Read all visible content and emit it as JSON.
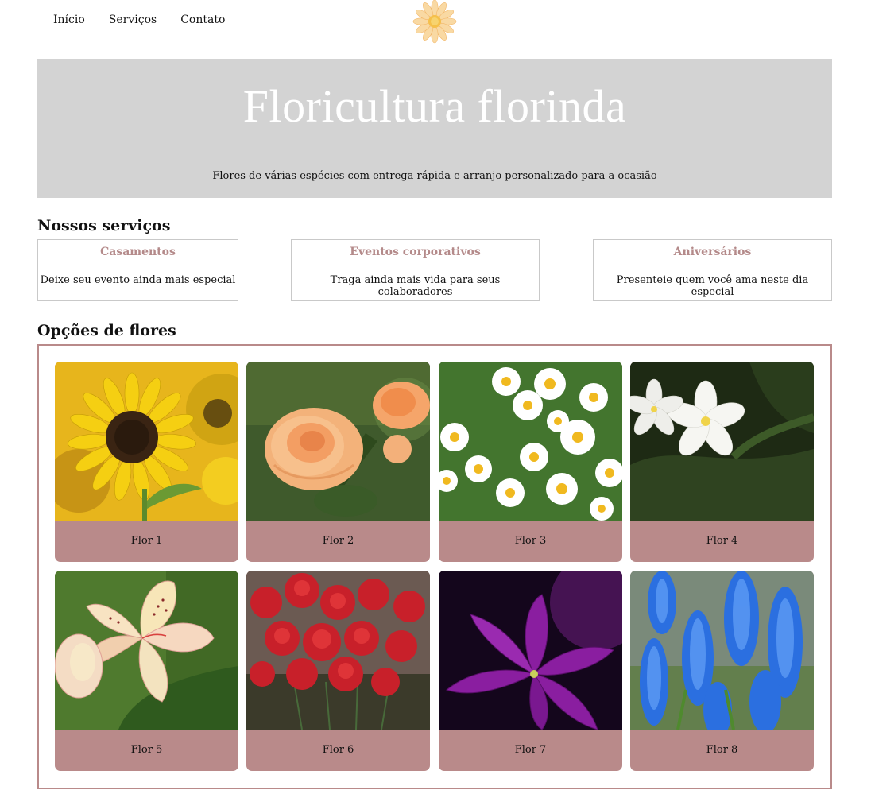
{
  "nav": {
    "items": [
      "Início",
      "Serviços",
      "Contato"
    ]
  },
  "logo": {
    "icon": "daisy-logo-icon"
  },
  "hero": {
    "title": "Floricultura florinda",
    "subtitle": "Flores de várias espécies com entrega rápida e arranjo personalizado para a ocasião"
  },
  "services": {
    "title": "Nossos serviços",
    "items": [
      {
        "title": "Casamentos",
        "text": "Deixe seu evento ainda mais especial"
      },
      {
        "title": "Eventos corporativos",
        "text": "Traga ainda mais vida para seus colaboradores"
      },
      {
        "title": "Aniversários",
        "text": "Presenteie quem você ama neste dia especial"
      }
    ]
  },
  "flowers": {
    "title": "Opções de flores",
    "items": [
      {
        "label": "Flor 1",
        "image": "sunflower"
      },
      {
        "label": "Flor 2",
        "image": "orange-rose"
      },
      {
        "label": "Flor 3",
        "image": "daisies"
      },
      {
        "label": "Flor 4",
        "image": "white-plumeria"
      },
      {
        "label": "Flor 5",
        "image": "alstroemeria"
      },
      {
        "label": "Flor 6",
        "image": "red-carnations"
      },
      {
        "label": "Flor 7",
        "image": "purple-hyacinth"
      },
      {
        "label": "Flor 8",
        "image": "blue-muscari"
      }
    ]
  },
  "colors": {
    "hero_bg": "#d3d3d3",
    "accent": "#b98a8a",
    "service_title": "#b48a8a"
  }
}
